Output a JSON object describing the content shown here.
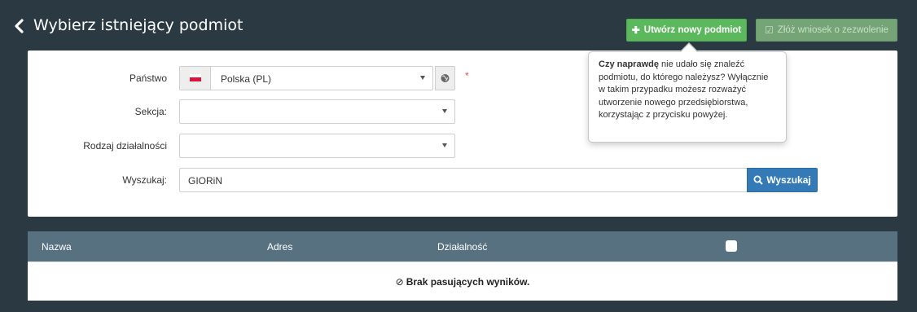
{
  "header": {
    "title": "Wybierz istniejący podmiot",
    "back_icon": "chevron-left-icon",
    "create_button": {
      "icon": "plus-icon",
      "label": "Utwórz nowy podmiot"
    },
    "apply_button": {
      "icon": "checkbox-edit-icon",
      "label": "Złóż wniosek o zezwolenie"
    }
  },
  "form": {
    "country": {
      "label": "Państwo",
      "value": "Polska (PL)",
      "flag": "poland-flag-icon",
      "required_mark": "*"
    },
    "section": {
      "label": "Sekcja:",
      "value": ""
    },
    "activity_type": {
      "label": "Rodzaj działalności",
      "value": ""
    },
    "search": {
      "label": "Wyszukaj:",
      "value": "GIORiN",
      "button_label": "Wyszukaj",
      "button_icon": "search-icon"
    }
  },
  "tooltip": {
    "bold": "Czy naprawdę",
    "text": " nie udało się znaleźć podmiotu, do którego należysz? Wyłącznie w takim przypadku możesz rozważyć utworzenie nowego przedsiębiorstwa, korzystając z przycisku powyżej."
  },
  "table": {
    "columns": [
      "Nazwa",
      "Adres",
      "Działalność"
    ],
    "empty_message": "Brak pasujących wyników.",
    "empty_icon": "ban-icon"
  },
  "colors": {
    "background": "#2b3a42",
    "create_button": "#5cb85c",
    "apply_button": "#75a576",
    "search_button": "#337ab7",
    "table_header": "#577180",
    "required": "#d9534f"
  }
}
